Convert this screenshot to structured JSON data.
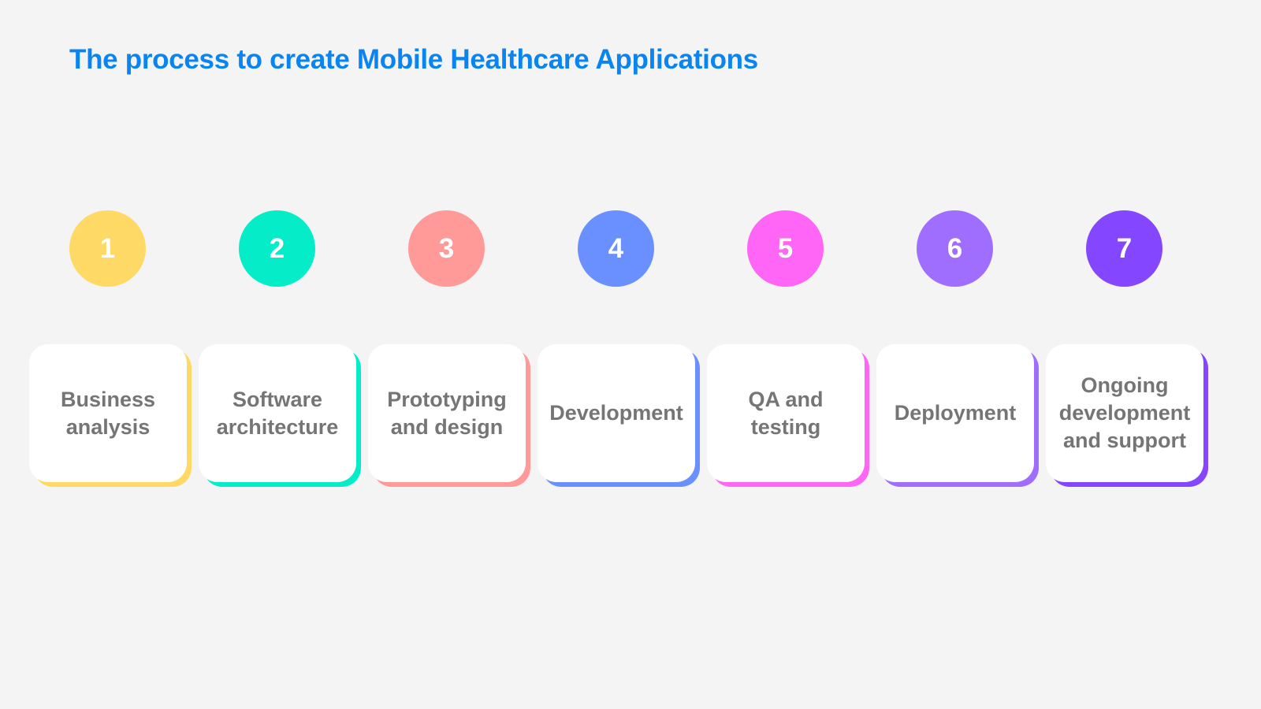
{
  "title": "The process to create Mobile Healthcare Applications",
  "colors": {
    "title": "#0a84f0",
    "background": "#f4f4f4",
    "card_text": "#757575"
  },
  "steps": [
    {
      "number": "1",
      "label": "Business\nanalysis",
      "color": "#ffd966"
    },
    {
      "number": "2",
      "label": "Software\narchitecture",
      "color": "#05edc8"
    },
    {
      "number": "3",
      "label": "Prototyping\nand design",
      "color": "#ff9a98"
    },
    {
      "number": "4",
      "label": "Development",
      "color": "#6a90ff"
    },
    {
      "number": "5",
      "label": "QA and\ntesting",
      "color": "#ff66f5"
    },
    {
      "number": "6",
      "label": "Deployment",
      "color": "#a06eff"
    },
    {
      "number": "7",
      "label": "Ongoing\ndevelopment\nand support",
      "color": "#8447ff"
    }
  ]
}
